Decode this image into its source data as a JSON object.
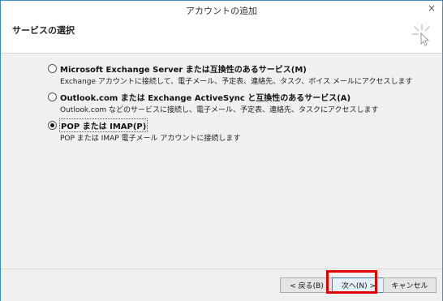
{
  "window": {
    "title": "アカウントの追加",
    "close_icon": "×"
  },
  "header": {
    "title": "サービスの選択",
    "icon": "wizard-sparkle-icon"
  },
  "options": [
    {
      "label": "Microsoft Exchange Server または互換性のあるサービス(M)",
      "description": "Exchange アカウントに接続して、電子メール、予定表、連絡先、タスク、ボイス メールにアクセスします",
      "selected": false
    },
    {
      "label": "Outlook.com または Exchange ActiveSync と互換性のあるサービス(A)",
      "description": "Outlook.com などのサービスに接続し、電子メール、予定表、連絡先、タスクにアクセスします",
      "selected": false
    },
    {
      "label": "POP または IMAP(P)",
      "description": "POP または IMAP 電子メール アカウントに接続します",
      "selected": true
    }
  ],
  "footer": {
    "back_label": "< 戻る(B)",
    "next_label": "次へ(N) >",
    "cancel_label": "キャンセル"
  },
  "colors": {
    "highlight": "#e00000",
    "window_border": "#3a8ac9"
  }
}
